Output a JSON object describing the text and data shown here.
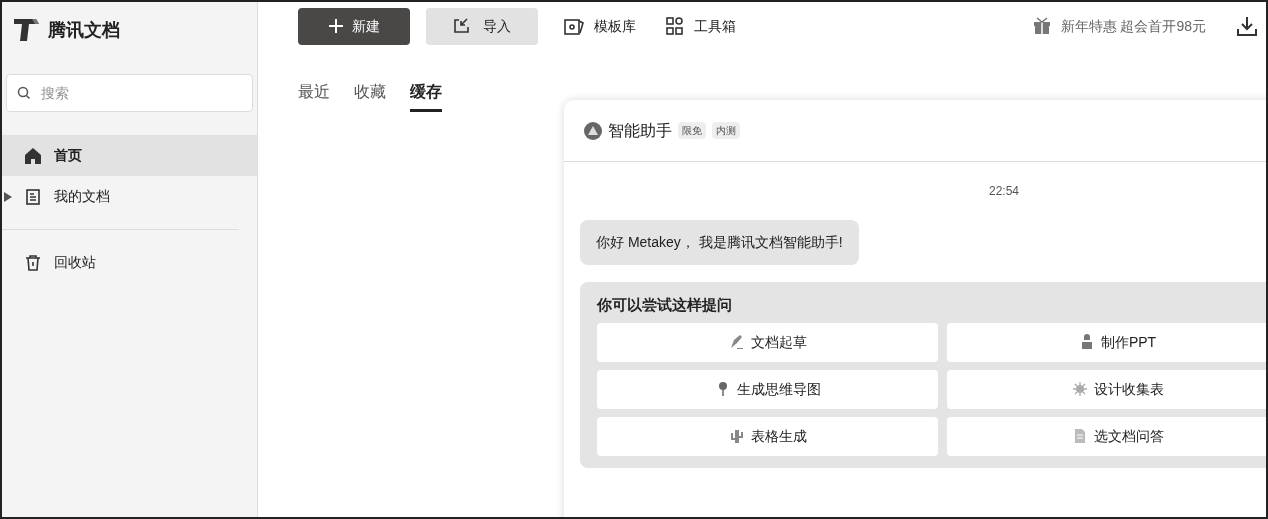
{
  "app": {
    "name": "腾讯文档"
  },
  "search": {
    "placeholder": "搜索"
  },
  "sidebar": {
    "sections": [
      [
        {
          "label": "首页",
          "selected": true
        },
        {
          "label": "我的文档",
          "selected": false,
          "expanded": false
        }
      ],
      [
        {
          "label": "回收站",
          "selected": false
        }
      ]
    ]
  },
  "toolbar": {
    "new_button": "新建",
    "import_button": "导入",
    "links": [
      "模板库",
      "工具箱"
    ],
    "promo": "新年特惠 超会首开98元"
  },
  "tabs": [
    {
      "label": "最近",
      "selected": false
    },
    {
      "label": "收藏",
      "selected": false
    },
    {
      "label": "缓存",
      "selected": true
    }
  ],
  "assistant": {
    "title": "智能助手",
    "badges": [
      "限免",
      "内测"
    ],
    "time": "22:54",
    "greeting": "你好 Metakey， 我是腾讯文档智能助手!",
    "suggestions_title": "你可以尝试这样提问",
    "suggestions": [
      "文档起草",
      "制作PPT",
      "生成思维导图",
      "设计收集表",
      "表格生成",
      "选文档问答"
    ]
  }
}
